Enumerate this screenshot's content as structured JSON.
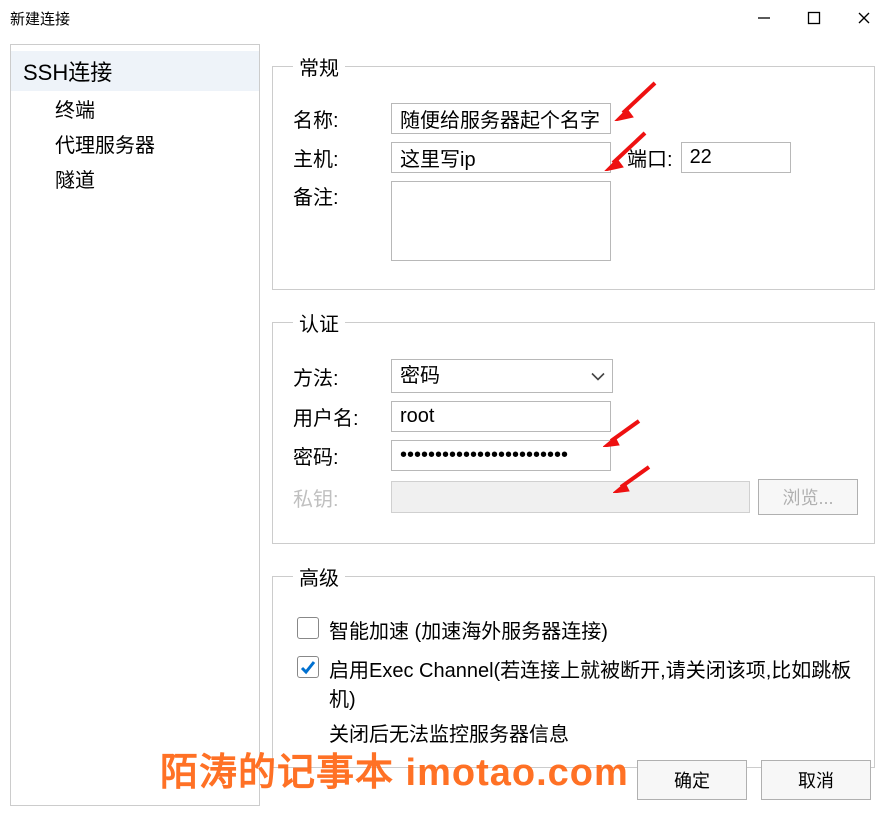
{
  "window": {
    "title": "新建连接"
  },
  "sidebar": {
    "root": "SSH连接",
    "items": [
      "终端",
      "代理服务器",
      "隧道"
    ]
  },
  "groups": {
    "general": {
      "legend": "常规"
    },
    "auth": {
      "legend": "认证"
    },
    "adv": {
      "legend": "高级"
    }
  },
  "general": {
    "name_label": "名称:",
    "name_value": "随便给服务器起个名字",
    "host_label": "主机:",
    "host_value": "这里写ip",
    "port_label": "端口:",
    "port_value": "22",
    "remark_label": "备注:",
    "remark_value": ""
  },
  "auth": {
    "method_label": "方法:",
    "method_value": "密码",
    "user_label": "用户名:",
    "user_value": "root",
    "pass_label": "密码:",
    "pass_value": "••••••••••••••••••••••••",
    "pk_label": "私钥:",
    "pk_value": "",
    "browse_label": "浏览..."
  },
  "adv": {
    "smart_accel": "智能加速 (加速海外服务器连接)",
    "exec_channel": "启用Exec Channel(若连接上就被断开,请关闭该项,比如跳板机)",
    "exec_note": "关闭后无法监控服务器信息"
  },
  "footer": {
    "ok": "确定",
    "cancel": "取消"
  },
  "watermark": "陌涛的记事本  imotao.com"
}
